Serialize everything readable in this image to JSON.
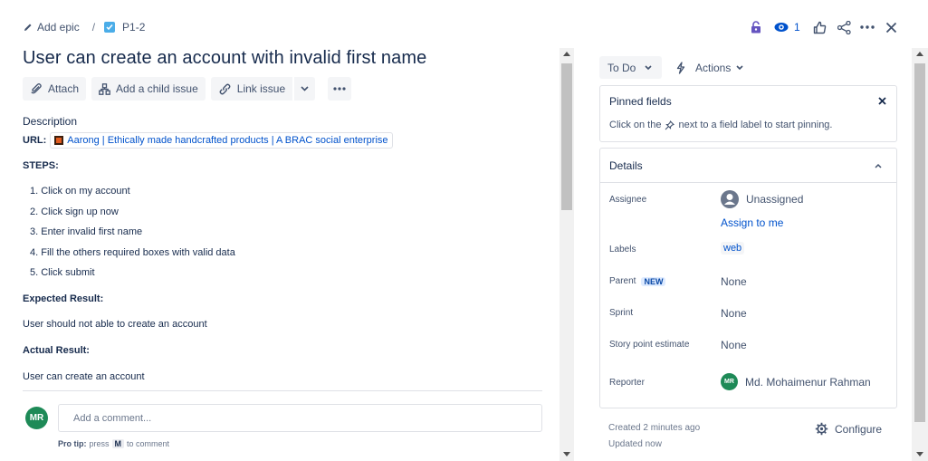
{
  "breadcrumb": {
    "add_epic": "Add epic",
    "separator": "/",
    "issue_key": "P1-2"
  },
  "header_actions": {
    "watch_count": "1"
  },
  "issue": {
    "title": "User can create an account with invalid first name"
  },
  "toolbar": {
    "attach": "Attach",
    "add_child": "Add a child issue",
    "link_issue": "Link issue"
  },
  "description": {
    "heading": "Description",
    "url_label": "URL:",
    "url_text": "Aarong | Ethically made handcrafted products | A BRAC social enterprise",
    "steps_heading": "STEPS:",
    "steps": [
      "1. Click on my account",
      "2. Click sign up now",
      "3. Enter invalid first name",
      "4. Fill the others required boxes with valid data",
      "5. Click submit"
    ],
    "expected_heading": "Expected Result:",
    "expected_text": "User should not able to create an account",
    "actual_heading": "Actual Result:",
    "actual_text": "User can create an account"
  },
  "comment": {
    "avatar_initials": "MR",
    "placeholder": "Add a comment...",
    "protip_label": "Pro tip:",
    "protip_press": "press",
    "protip_key": "M",
    "protip_rest": "to comment"
  },
  "status": {
    "label": "To Do",
    "actions": "Actions"
  },
  "pinned": {
    "title": "Pinned fields",
    "hint_before": "Click on the",
    "hint_after": "next to a field label to start pinning."
  },
  "details": {
    "title": "Details",
    "assignee_label": "Assignee",
    "assignee_value": "Unassigned",
    "assign_to_me": "Assign to me",
    "labels_label": "Labels",
    "labels_value": "web",
    "parent_label": "Parent",
    "parent_badge": "NEW",
    "parent_value": "None",
    "sprint_label": "Sprint",
    "sprint_value": "None",
    "story_points_label": "Story point estimate",
    "story_points_value": "None",
    "reporter_label": "Reporter",
    "reporter_initials": "MR",
    "reporter_value": "Md. Mohaimenur Rahman"
  },
  "footer": {
    "created": "Created 2 minutes ago",
    "updated": "Updated now",
    "configure": "Configure"
  },
  "colors": {
    "accent": "#0052cc",
    "avatar": "#1e8a57",
    "lock": "#6554c0",
    "watch": "#0052cc",
    "story": "#4bade8"
  }
}
